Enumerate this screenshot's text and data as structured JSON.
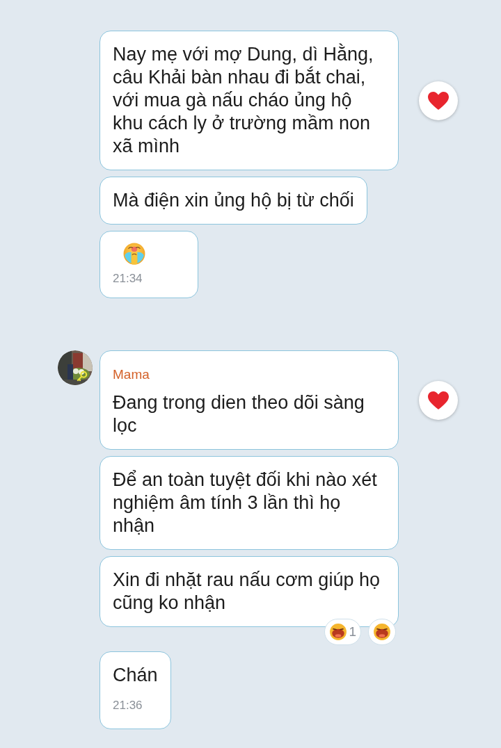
{
  "groups": [
    {
      "messages": [
        {
          "kind": "text",
          "text": "Nay mẹ với mợ Dung, dì Hằng, câu Khải bàn nhau đi bắt chai, với mua gà nấu cháo ủng hộ khu cách ly ở trường mầm non xã mình",
          "liked": true
        },
        {
          "kind": "text",
          "text": "Mà điện xin ủng hộ bị từ chối",
          "liked": false
        },
        {
          "kind": "sticker",
          "time": "21:34",
          "liked": false
        }
      ]
    },
    {
      "sender": "Mama",
      "messages": [
        {
          "kind": "text",
          "text": "Đang trong dien theo dõi sàng lọc",
          "liked": true
        },
        {
          "kind": "text",
          "text": "Để an toàn tuyệt đối khi nào xét nghiệm âm tính 3 lần thì họ nhận",
          "liked": false
        },
        {
          "kind": "text",
          "text": "Xin đi nhặt rau nấu cơm giúp họ cũng ko nhận",
          "liked": false,
          "reactions": [
            {
              "kind": "count",
              "count": "1"
            },
            {
              "kind": "react_button"
            }
          ]
        },
        {
          "kind": "text",
          "text": "Chán",
          "time": "21:36",
          "liked": false
        }
      ]
    }
  ]
}
